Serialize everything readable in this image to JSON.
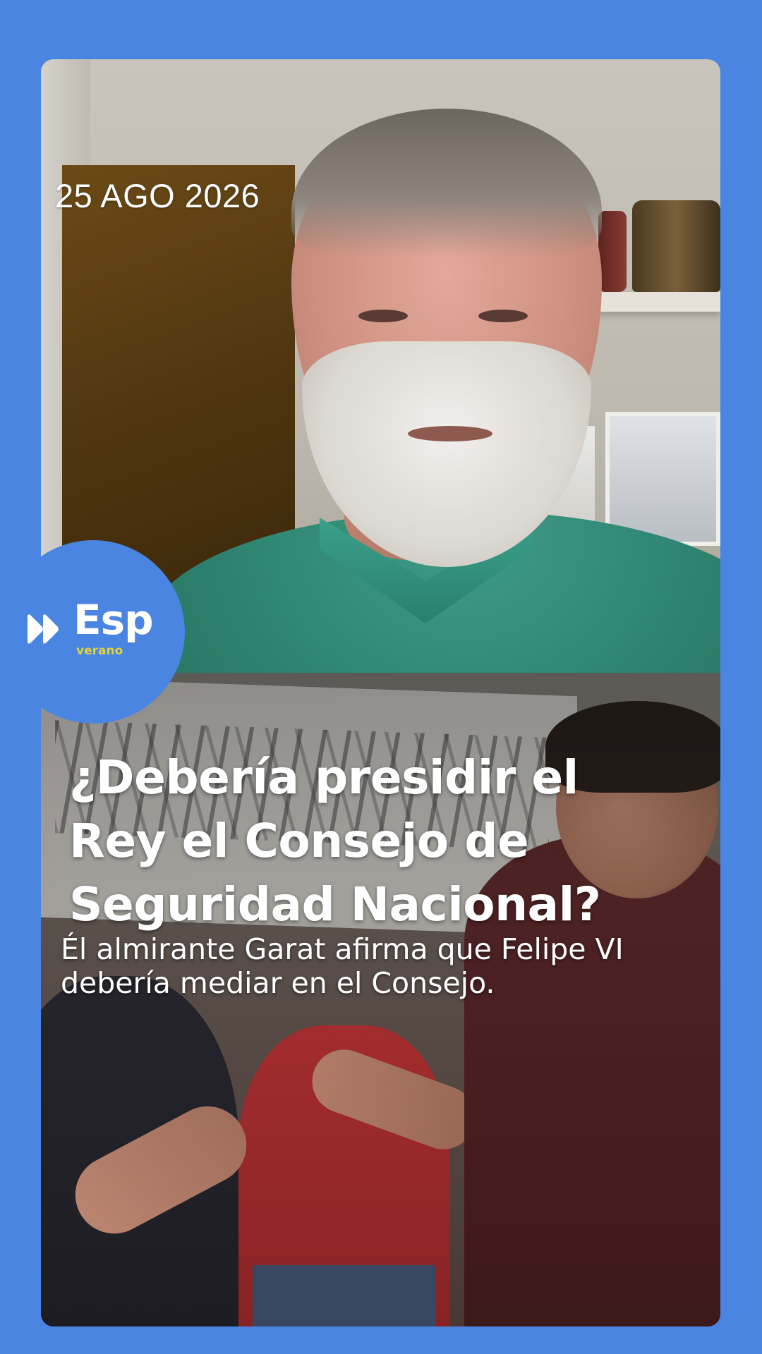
{
  "story": {
    "date": "25 AGO 2026",
    "headline": "¿Debería presidir el Rey el Consejo de Seguridad Nacional?",
    "subheadline": "Él almirante Garat afirma que Felipe VI debería mediar en el Consejo."
  },
  "brand": {
    "name": "Esp",
    "tagline": "verano",
    "logo_icon": "double-play-icon",
    "colors": {
      "background": "#4a85e2",
      "tagline": "#e0d33a",
      "text": "#ffffff"
    }
  },
  "media": {
    "top_frame": "interview-video-frame",
    "bottom_frame": "protest-video-frame"
  }
}
